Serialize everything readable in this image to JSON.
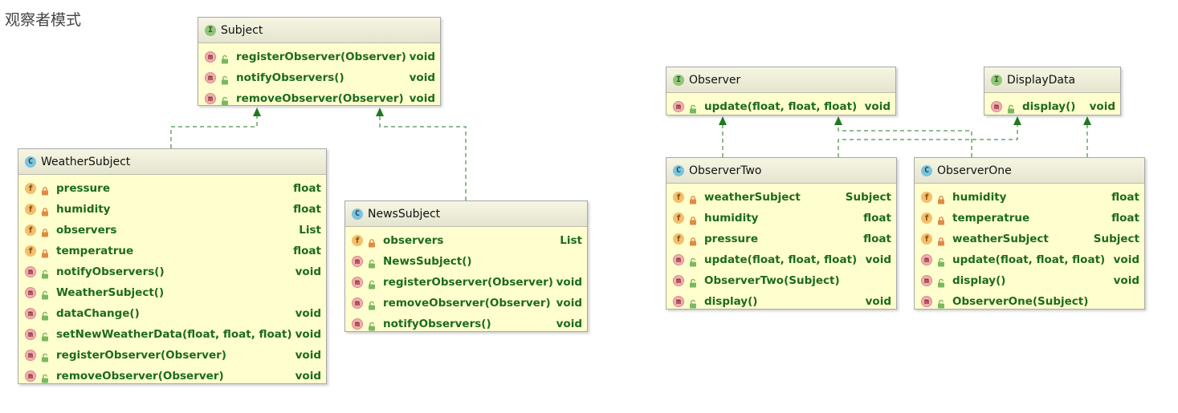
{
  "title": "观察者模式",
  "classes": {
    "subject": {
      "name": "Subject",
      "kind": "I",
      "members": [
        {
          "kind": "m",
          "vis": "public",
          "name": "registerObserver(Observer)",
          "type": "void"
        },
        {
          "kind": "m",
          "vis": "public",
          "name": "notifyObservers()",
          "type": "void"
        },
        {
          "kind": "m",
          "vis": "public",
          "name": "removeObserver(Observer)",
          "type": "void"
        }
      ]
    },
    "weatherSubject": {
      "name": "WeatherSubject",
      "kind": "C",
      "members": [
        {
          "kind": "f",
          "vis": "private",
          "name": "pressure",
          "type": "float"
        },
        {
          "kind": "f",
          "vis": "private",
          "name": "humidity",
          "type": "float"
        },
        {
          "kind": "f",
          "vis": "private",
          "name": "observers",
          "type": "List"
        },
        {
          "kind": "f",
          "vis": "private",
          "name": "temperatrue",
          "type": "float"
        },
        {
          "kind": "m",
          "vis": "public",
          "name": "notifyObservers()",
          "type": "void"
        },
        {
          "kind": "m",
          "vis": "public",
          "name": "WeatherSubject()",
          "type": ""
        },
        {
          "kind": "m",
          "vis": "public",
          "name": "dataChange()",
          "type": "void"
        },
        {
          "kind": "m",
          "vis": "public",
          "name": "setNewWeatherData(float, float, float)",
          "type": "void"
        },
        {
          "kind": "m",
          "vis": "public",
          "name": "registerObserver(Observer)",
          "type": "void"
        },
        {
          "kind": "m",
          "vis": "public",
          "name": "removeObserver(Observer)",
          "type": "void"
        }
      ]
    },
    "newsSubject": {
      "name": "NewsSubject",
      "kind": "C",
      "members": [
        {
          "kind": "f",
          "vis": "private",
          "name": "observers",
          "type": "List"
        },
        {
          "kind": "m",
          "vis": "public",
          "name": "NewsSubject()",
          "type": ""
        },
        {
          "kind": "m",
          "vis": "public",
          "name": "registerObserver(Observer)",
          "type": "void"
        },
        {
          "kind": "m",
          "vis": "public",
          "name": "removeObserver(Observer)",
          "type": "void"
        },
        {
          "kind": "m",
          "vis": "public",
          "name": "notifyObservers()",
          "type": "void"
        }
      ]
    },
    "observer": {
      "name": "Observer",
      "kind": "I",
      "members": [
        {
          "kind": "m",
          "vis": "public",
          "name": "update(float, float, float)",
          "type": "void"
        }
      ]
    },
    "displayData": {
      "name": "DisplayData",
      "kind": "I",
      "members": [
        {
          "kind": "m",
          "vis": "public",
          "name": "display()",
          "type": "void"
        }
      ]
    },
    "observerTwo": {
      "name": "ObserverTwo",
      "kind": "C",
      "members": [
        {
          "kind": "f",
          "vis": "private",
          "name": "weatherSubject",
          "type": "Subject"
        },
        {
          "kind": "f",
          "vis": "private",
          "name": "humidity",
          "type": "float"
        },
        {
          "kind": "f",
          "vis": "private",
          "name": "pressure",
          "type": "float"
        },
        {
          "kind": "m",
          "vis": "public",
          "name": "update(float, float, float)",
          "type": "void"
        },
        {
          "kind": "m",
          "vis": "public",
          "name": "ObserverTwo(Subject)",
          "type": ""
        },
        {
          "kind": "m",
          "vis": "public",
          "name": "display()",
          "type": "void"
        }
      ]
    },
    "observerOne": {
      "name": "ObserverOne",
      "kind": "C",
      "members": [
        {
          "kind": "f",
          "vis": "private",
          "name": "humidity",
          "type": "float"
        },
        {
          "kind": "f",
          "vis": "private",
          "name": "temperatrue",
          "type": "float"
        },
        {
          "kind": "f",
          "vis": "private",
          "name": "weatherSubject",
          "type": "Subject"
        },
        {
          "kind": "m",
          "vis": "public",
          "name": "update(float, float, float)",
          "type": "void"
        },
        {
          "kind": "m",
          "vis": "public",
          "name": "display()",
          "type": "void"
        },
        {
          "kind": "m",
          "vis": "public",
          "name": "ObserverOne(Subject)",
          "type": ""
        }
      ]
    }
  },
  "relations": [
    {
      "from": "weatherSubject",
      "to": "subject",
      "type": "implements"
    },
    {
      "from": "newsSubject",
      "to": "subject",
      "type": "implements"
    },
    {
      "from": "observerTwo",
      "to": "observer",
      "type": "implements"
    },
    {
      "from": "observerTwo",
      "to": "displayData",
      "type": "implements"
    },
    {
      "from": "observerOne",
      "to": "observer",
      "type": "implements"
    },
    {
      "from": "observerOne",
      "to": "displayData",
      "type": "implements"
    }
  ],
  "colors": {
    "box_fill": "#fefece",
    "member_text": "#1d6b1d",
    "arrow": "#1f7a1f",
    "interface_badge": "#8fc67b",
    "class_badge": "#7ec3dd",
    "field_badge": "#f4be6e",
    "method_badge": "#f2aeb0"
  }
}
